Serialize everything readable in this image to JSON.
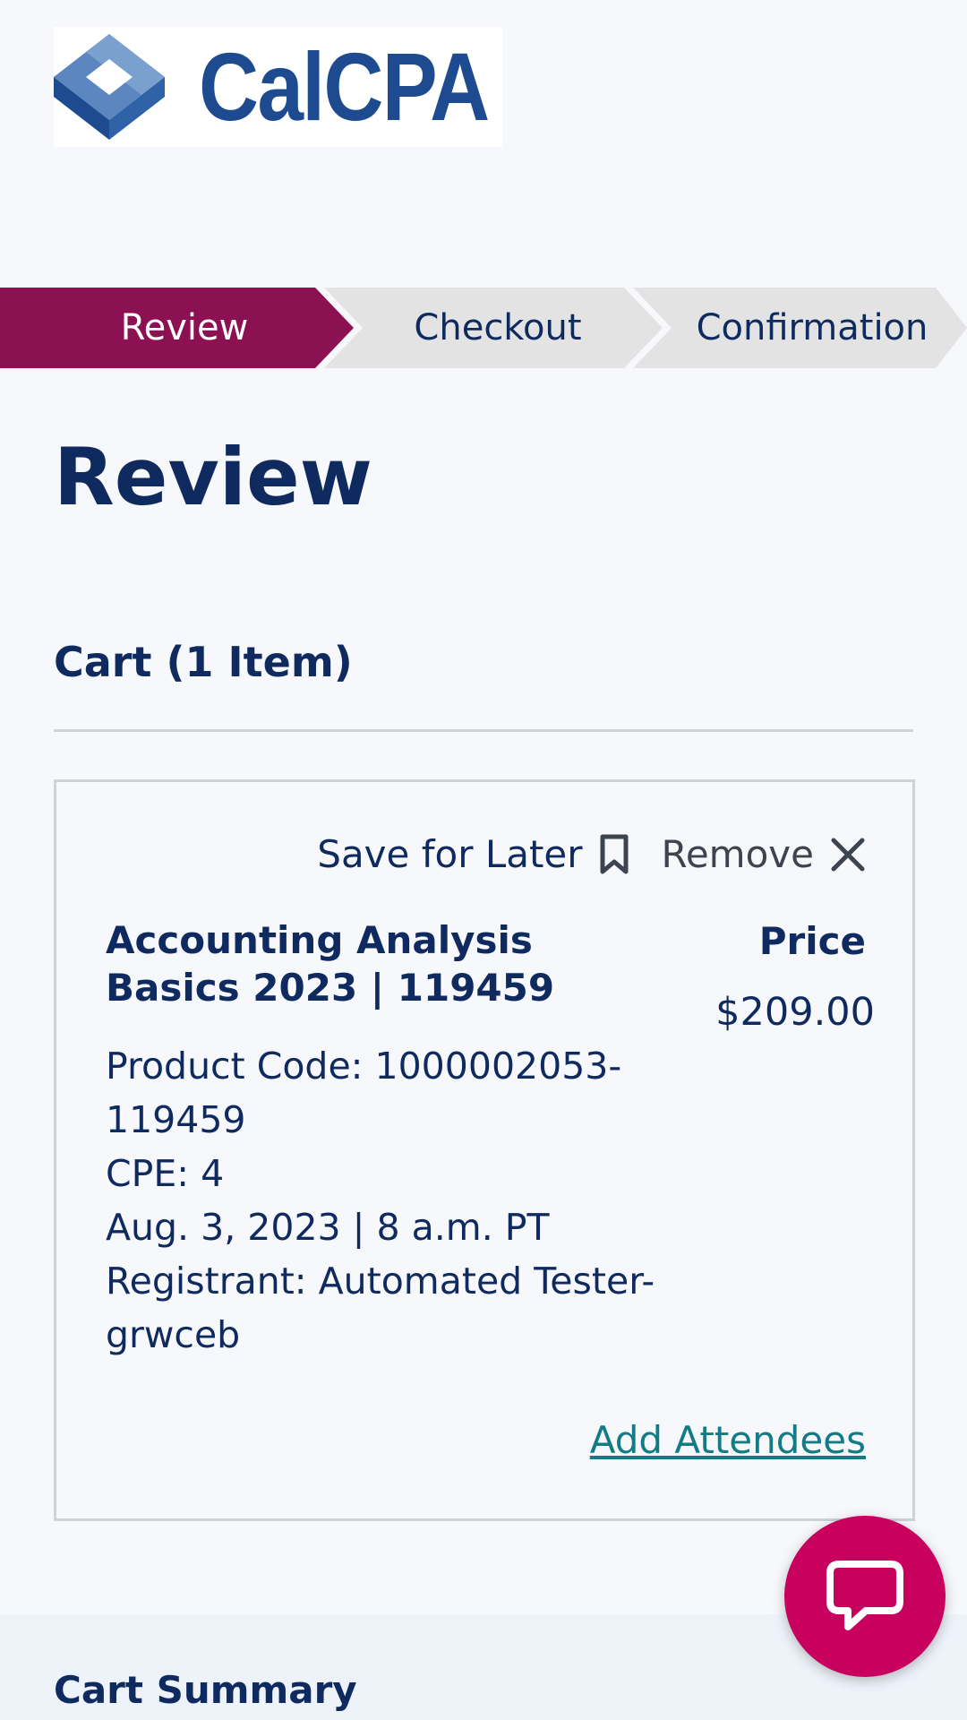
{
  "brand": {
    "name": "CalCPA"
  },
  "steps": [
    {
      "label": "Review",
      "active": true
    },
    {
      "label": "Checkout",
      "active": false
    },
    {
      "label": "Confirmation",
      "active": false
    }
  ],
  "page_title": "Review",
  "cart": {
    "heading": "Cart (1 Item)",
    "item": {
      "save_for_later_label": "Save for Later",
      "remove_label": "Remove",
      "title": "Accounting Analysis Basics 2023 | 119459",
      "details": [
        "Product Code: 1000002053-119459",
        "CPE: 4",
        "Aug. 3, 2023 | 8 a.m. PT",
        "Registrant: Automated Tester-grwceb"
      ],
      "price_label": "Price",
      "price": "$209.00",
      "add_attendees_label": "Add Attendees"
    }
  },
  "summary": {
    "heading": "Cart Summary"
  },
  "colors": {
    "active_step": "#8b1153",
    "inactive_step": "#e3e3e3",
    "heading": "#0f2a5f",
    "link": "#127b86",
    "chat": "#c8005e",
    "logo": "#1e4b8f"
  },
  "icons": {
    "save_for_later": "bookmark-icon",
    "remove": "close-icon",
    "chat": "chat-bubble-icon"
  }
}
